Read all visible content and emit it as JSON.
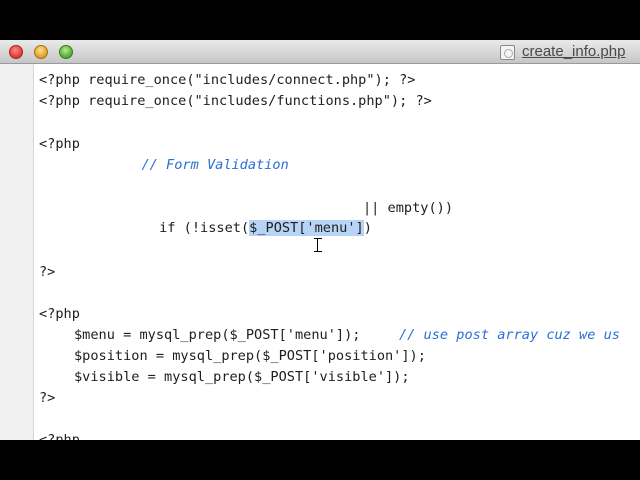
{
  "window": {
    "title": "create_info.php"
  },
  "code_lines": [
    "<?php require_once(\"includes/connect.php\"); ?>",
    "<?php require_once(\"includes/functions.php\"); ?>",
    "<?php",
    "        // Form Validation",
    "if (!isset($_POST['menu'])",
    "|| empty())",
    "?>",
    "<?php",
    "$menu = mysql_prep($_POST['menu']);",
    "// use post array cuz we us",
    "$position = mysql_prep($_POST['position']);",
    "$visible = mysql_prep($_POST['visible']);",
    "?>",
    "<?php"
  ],
  "highlight": {
    "selected_text": "$_POST['menu']"
  }
}
